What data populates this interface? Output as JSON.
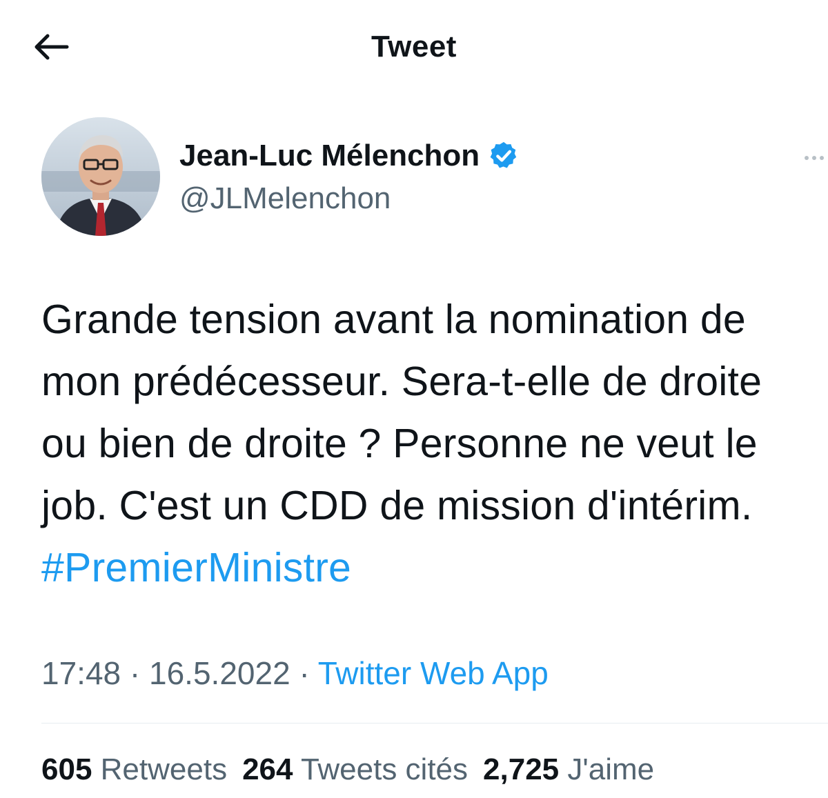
{
  "header": {
    "title": "Tweet",
    "back_icon": "arrow-left-icon"
  },
  "author": {
    "display_name": "Jean-Luc Mélenchon",
    "handle": "@JLMelenchon",
    "verified_icon": "verified-badge-icon",
    "more_icon": "more-dots-icon"
  },
  "tweet": {
    "text": "Grande tension avant la nomination de mon prédécesseur. Sera-t-elle de droite ou bien de droite ? Personne ne veut le job. C'est un CDD de mission d'intérim. ",
    "hashtag": "#PremierMinistre"
  },
  "meta": {
    "time": "17:48",
    "separator": " · ",
    "date": "16.5.2022",
    "source": "Twitter Web App"
  },
  "stats": {
    "retweets_count": "605",
    "retweets_label": "Retweets",
    "quotes_count": "264",
    "quotes_label": "Tweets cités",
    "likes_count": "2,725",
    "likes_label": "J'aime"
  },
  "colors": {
    "link": "#1d9bf0",
    "secondary_text": "#536471",
    "primary_text": "#0f1419"
  }
}
